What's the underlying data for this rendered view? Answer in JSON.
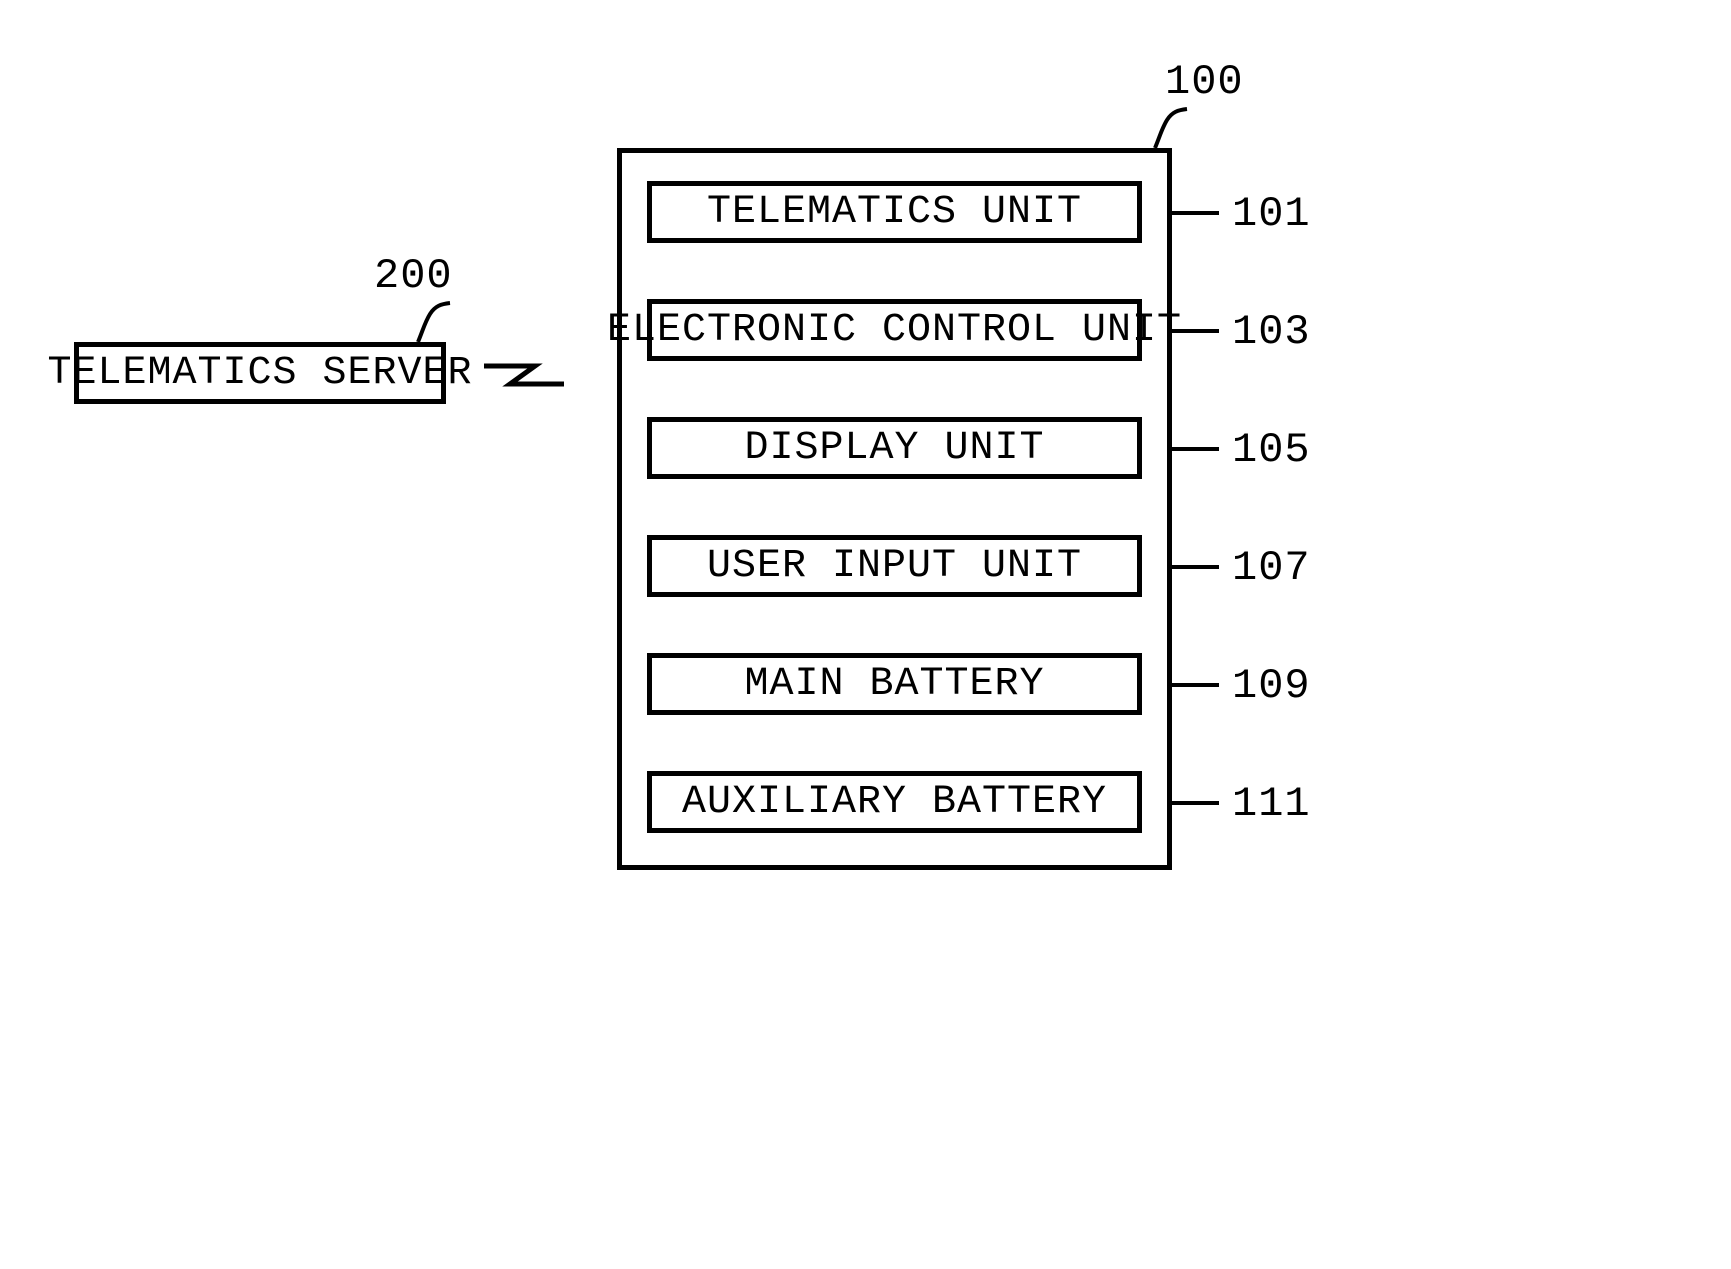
{
  "server": {
    "label": "TELEMATICS SERVER",
    "ref": "200"
  },
  "container": {
    "ref": "100",
    "units": [
      {
        "label": "TELEMATICS UNIT",
        "ref": "101"
      },
      {
        "label": "ELECTRONIC CONTROL UNIT",
        "ref": "103"
      },
      {
        "label": "DISPLAY UNIT",
        "ref": "105"
      },
      {
        "label": "USER INPUT UNIT",
        "ref": "107"
      },
      {
        "label": "MAIN BATTERY",
        "ref": "109"
      },
      {
        "label": "AUXILIARY BATTERY",
        "ref": "111"
      }
    ]
  }
}
